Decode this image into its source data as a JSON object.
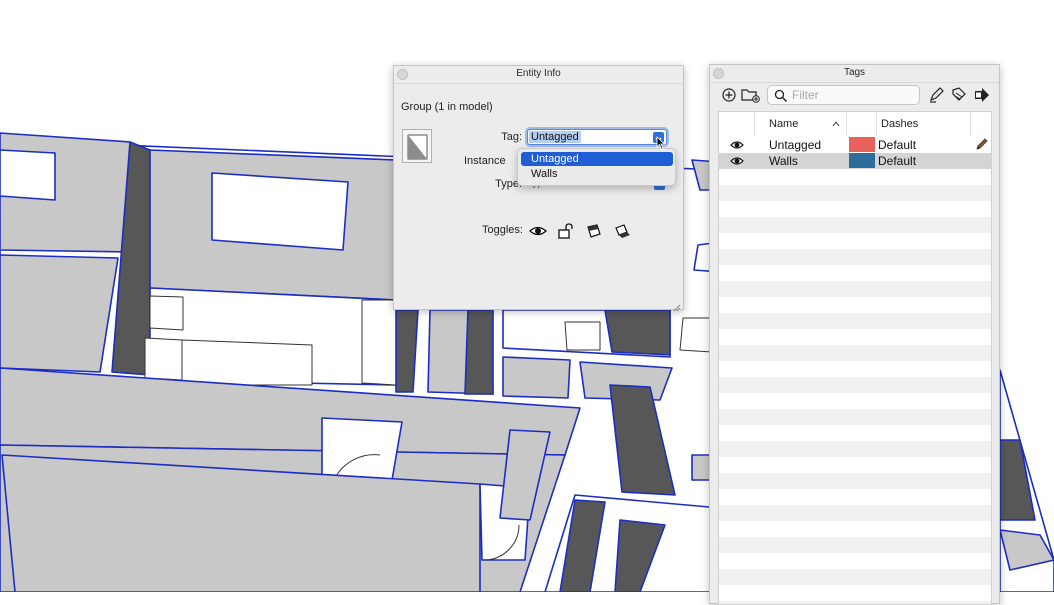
{
  "entity_info": {
    "title": "Entity Info",
    "heading": "Group (1 in model)",
    "tag_label": "Tag:",
    "tag_value": "Untagged",
    "instance_label": "Instance",
    "type_label": "Type:",
    "type_value": "Type: <undefined>",
    "toggles_label": "Toggles:",
    "toggle_icons": [
      "eye-icon",
      "lock-icon",
      "receive-shadows-icon",
      "cast-shadows-icon"
    ]
  },
  "tag_dropdown": {
    "options": [
      "Untagged",
      "Walls"
    ],
    "selected": "Untagged"
  },
  "tags_panel": {
    "title": "Tags",
    "filter_placeholder": "Filter",
    "columns": {
      "name": "Name",
      "dashes": "Dashes"
    },
    "rows": [
      {
        "name": "Untagged",
        "color": "#e8625c",
        "dashes": "Default",
        "visible": true,
        "active": true
      },
      {
        "name": "Walls",
        "color": "#2e6d99",
        "dashes": "Default",
        "visible": true,
        "active": false
      }
    ]
  },
  "colors": {
    "selection_blue": "#1f5ed4",
    "model_edge_blue": "#1c2dc2",
    "wall_gray": "#c8c8c8",
    "shadow_gray": "#575757"
  }
}
